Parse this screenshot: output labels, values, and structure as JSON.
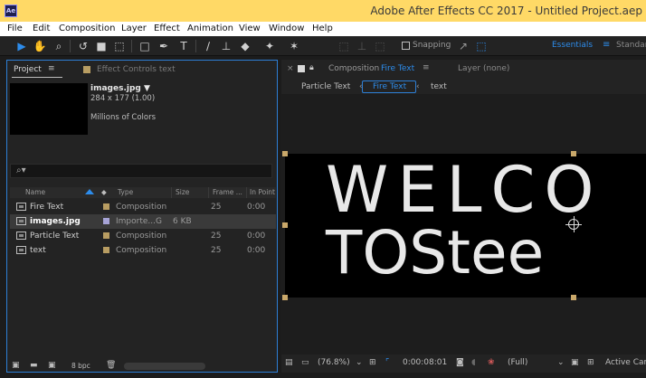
{
  "app": {
    "icon_text": "Ae",
    "window_title": "Adobe After Effects CC 2017 - Untitled Project.aep"
  },
  "menu": [
    "File",
    "Edit",
    "Composition",
    "Layer",
    "Effect",
    "Animation",
    "View",
    "Window",
    "Help"
  ],
  "toolbar": {
    "snapping_label": "Snapping",
    "workspace_label": "Essentials",
    "next_workspace": "Standard"
  },
  "project_panel": {
    "tab_project": "Project",
    "tab_effect_controls": "Effect Controls text",
    "selected_item": {
      "name": "images.jpg ▼",
      "dimensions": "284 x 177 (1.00)",
      "colors": "Millions of Colors"
    },
    "search_placeholder": "",
    "columns": [
      "Name",
      "Type",
      "Size",
      "Frame ...",
      "In Point"
    ],
    "items": [
      {
        "name": "Fire Text",
        "type": "Composition",
        "size": "",
        "frame_rate": "25",
        "in_point": "0:00",
        "label_color": "#b89d62",
        "selected": false
      },
      {
        "name": "images.jpg",
        "type": "Importe...G",
        "size": "6 KB",
        "frame_rate": "",
        "in_point": "",
        "label_color": "#a6a3d6",
        "selected": true
      },
      {
        "name": "Particle Text",
        "type": "Composition",
        "size": "",
        "frame_rate": "25",
        "in_point": "0:00",
        "label_color": "#b89d62",
        "selected": false
      },
      {
        "name": "text",
        "type": "Composition",
        "size": "",
        "frame_rate": "25",
        "in_point": "0:00",
        "label_color": "#b89d62",
        "selected": false
      }
    ],
    "bit_depth": "8 bpc"
  },
  "composition_panel": {
    "tab_label": "Composition",
    "comp_name": "Fire Text",
    "layer_label": "Layer (none)",
    "breadcrumbs": [
      "Particle Text",
      "Fire Text",
      "text"
    ],
    "canvas_text_line1": "WELCO",
    "canvas_text_line2": "TOStee",
    "zoom": "(76.8%)",
    "timecode": "0:00:08:01",
    "resolution": "(Full)",
    "camera": "Active Cam"
  },
  "colors": {
    "title_bar": "#ffd966",
    "accent_blue": "#2d8ceb",
    "label_sandstone": "#b89d62",
    "label_lavender": "#a6a3d6"
  }
}
